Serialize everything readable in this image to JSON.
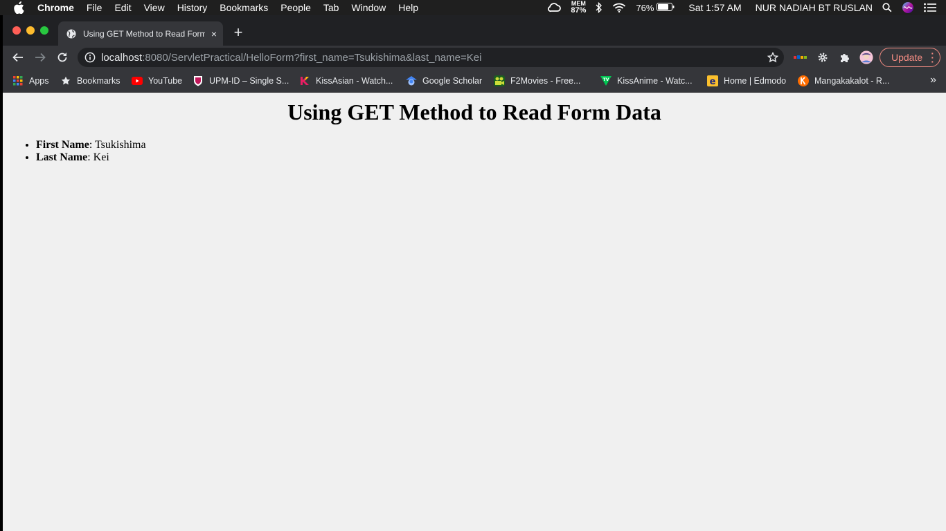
{
  "menubar": {
    "app_name": "Chrome",
    "items": [
      "File",
      "Edit",
      "View",
      "History",
      "Bookmarks",
      "People",
      "Tab",
      "Window",
      "Help"
    ],
    "mem_label": "MEM",
    "mem_value": "87%",
    "battery": "76%",
    "clock": "Sat 1:57 AM",
    "user": "NUR NADIAH BT RUSLAN"
  },
  "tab": {
    "title": "Using GET Method to Read Form Data",
    "close": "×",
    "new_tab": "+"
  },
  "omnibox": {
    "host": "localhost",
    "rest": ":8080/ServletPractical/HelloForm?first_name=Tsukishima&last_name=Kei"
  },
  "toolbar": {
    "update_label": "Update"
  },
  "bookmarks": [
    {
      "label": "Apps",
      "icon": "apps-grid-icon"
    },
    {
      "label": "Bookmarks",
      "icon": "star-icon"
    },
    {
      "label": "YouTube",
      "icon": "youtube-icon"
    },
    {
      "label": "UPM-ID – Single S...",
      "icon": "upm-shield-icon"
    },
    {
      "label": "KissAsian - Watch...",
      "icon": "kissasian-icon"
    },
    {
      "label": "Google Scholar",
      "icon": "scholar-icon"
    },
    {
      "label": "F2Movies - Free...",
      "icon": "f2movies-icon"
    },
    {
      "label": "KissAnime - Watc...",
      "icon": "kissanime-icon"
    },
    {
      "label": "Home | Edmodo",
      "icon": "edmodo-icon"
    },
    {
      "label": "Mangakakalot - R...",
      "icon": "mangakakalot-icon"
    }
  ],
  "page": {
    "heading": "Using GET Method to Read Form Data",
    "fields": [
      {
        "label": "First Name",
        "value": "Tsukishima"
      },
      {
        "label": "Last Name",
        "value": "Kei"
      }
    ]
  },
  "colors": {
    "accent_update": "#f28b82",
    "tab_bg": "#35363a",
    "page_bg": "#f0f0f0"
  }
}
